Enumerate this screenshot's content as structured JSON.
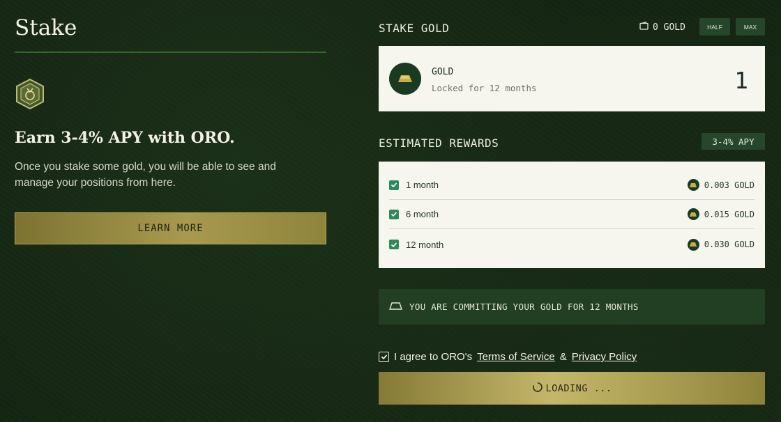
{
  "left": {
    "title": "Stake",
    "headline": "Earn 3-4% APY with ORO.",
    "description": "Once you stake some gold, you will be able to see and manage your positions from here.",
    "learn_more_label": "LEARN MORE",
    "hero_icon": "gold-vault-icon"
  },
  "stake": {
    "title": "STAKE GOLD",
    "balance": "0 GOLD",
    "balance_icon": "wallet-icon",
    "half_label": "HALF",
    "max_label": "MAX",
    "asset_name": "GOLD",
    "asset_sub": "Locked for 12 months",
    "amount": "1"
  },
  "rewards": {
    "title": "ESTIMATED REWARDS",
    "apy": "3-4% APY",
    "rows": [
      {
        "period": "1 month",
        "value": "0.003 GOLD"
      },
      {
        "period": "6 month",
        "value": "0.015 GOLD"
      },
      {
        "period": "12 month",
        "value": "0.030 GOLD"
      }
    ]
  },
  "commit": {
    "text": "YOU ARE COMMITTING YOUR GOLD FOR 12 MONTHS",
    "icon": "gold-bar-icon"
  },
  "agree": {
    "prefix": "I agree to ORO's",
    "terms": "Terms of Service",
    "amp": "&",
    "privacy": "Privacy Policy"
  },
  "submit": {
    "label": "LOADING ...",
    "icon": "spinner-icon"
  },
  "colors": {
    "background": "#142412",
    "card": "#f6f5ee",
    "accent_gold": "#a79a4f",
    "badge_green": "#25472b",
    "check_green": "#2c8a5c"
  }
}
